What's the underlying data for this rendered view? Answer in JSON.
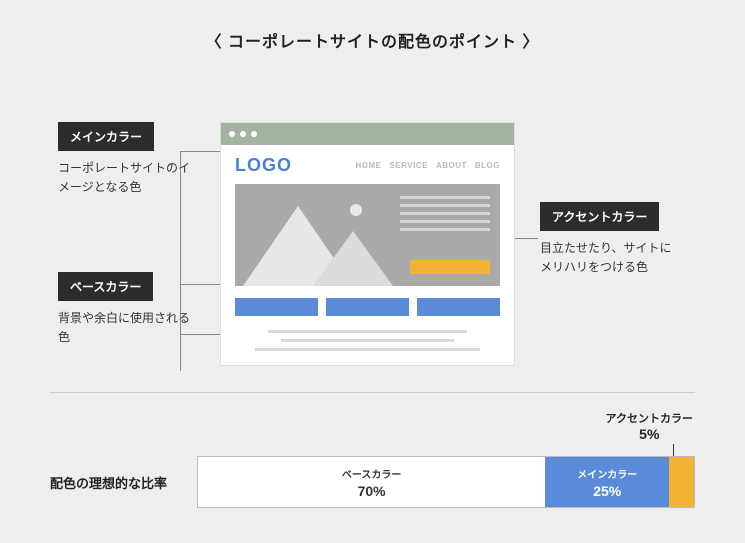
{
  "title": "〈 コーポレートサイトの配色のポイント 〉",
  "labels": {
    "main": {
      "tag": "メインカラー",
      "desc": "コーポレートサイトのイメージとなる色"
    },
    "base": {
      "tag": "ベースカラー",
      "desc": "背景や余白に使用される色"
    },
    "accent": {
      "tag": "アクセントカラー",
      "desc": "目立たせたり、サイトにメリハリをつける色"
    }
  },
  "mockup": {
    "logo": "LOGO",
    "nav": [
      "HOME",
      "SERVICE",
      "ABOUT",
      "BLOG"
    ]
  },
  "ratio": {
    "title": "配色の理想的な比率",
    "accent_top": "アクセントカラー",
    "accent_pct_top": "5%"
  },
  "colors": {
    "main": "#5a8bd8",
    "accent": "#f2b233",
    "base": "#ffffff"
  },
  "chart_data": {
    "type": "bar",
    "title": "配色の理想的な比率",
    "categories": [
      "ベースカラー",
      "メインカラー",
      "アクセントカラー"
    ],
    "values": [
      70,
      25,
      5
    ],
    "series": [
      {
        "name": "ベースカラー",
        "pct": "70%",
        "value": 70,
        "color": "#ffffff"
      },
      {
        "name": "メインカラー",
        "pct": "25%",
        "value": 25,
        "color": "#5a8bd8"
      },
      {
        "name": "アクセントカラー",
        "pct": "5%",
        "value": 5,
        "color": "#f2b233"
      }
    ],
    "xlabel": "",
    "ylabel": "",
    "ylim": [
      0,
      100
    ]
  }
}
